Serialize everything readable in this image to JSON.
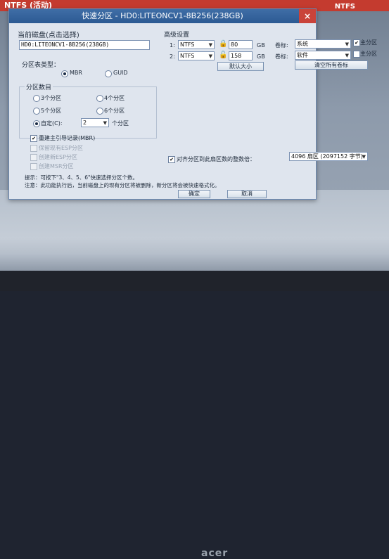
{
  "window": {
    "title": "快速分区 - HD0:LITEONCV1-8B256(238GB)",
    "close_glyph": "×"
  },
  "background": {
    "top_left": "NTFS (活动)",
    "top_right": "NTFS",
    "bezel_brand": "acer"
  },
  "disk": {
    "label": "当前磁盘(点击选择)",
    "value": "HD0:LITEONCV1-8B256(238GB)"
  },
  "partition_type": {
    "label": "分区表类型：",
    "options": [
      "MBR",
      "GUID"
    ],
    "selected": "MBR"
  },
  "partition_count": {
    "label": "分区数目",
    "options": [
      "3个分区",
      "4个分区",
      "5个分区",
      "6个分区"
    ],
    "custom_label": "自定(C):",
    "custom_value": "2",
    "custom_suffix": "个分区"
  },
  "options": {
    "rebuild_mbr": "重建主引导记录(MBR)",
    "keep_esp": "保留现有ESP分区",
    "create_esp": "创建新ESP分区",
    "create_msr": "创建MSR分区"
  },
  "advanced": {
    "label": "高级设置",
    "rows": [
      {
        "index": "1:",
        "fs": "NTFS",
        "size": "80",
        "unit": "GB",
        "vol_label": "卷标:",
        "vol_value": "系统",
        "primary": "主分区"
      },
      {
        "index": "2:",
        "fs": "NTFS",
        "size": "158",
        "unit": "GB",
        "vol_label": "卷标:",
        "vol_value": "软件",
        "primary": "主分区"
      }
    ],
    "default_size_btn": "默认大小",
    "clear_labels_btn": "清空所有卷标"
  },
  "align": {
    "label": "对齐分区到此扇区数的整数倍：",
    "value": "4096 扇区 (2097152 字节)"
  },
  "tips": {
    "line1": "提示：可按下\"3、4、5、6\"快速选择分区个数。",
    "line2": "注意：此功能执行后，当前磁盘上的现有分区将被删除，新分区将会被快速格式化。"
  },
  "buttons": {
    "ok": "确定",
    "cancel": "取消"
  }
}
